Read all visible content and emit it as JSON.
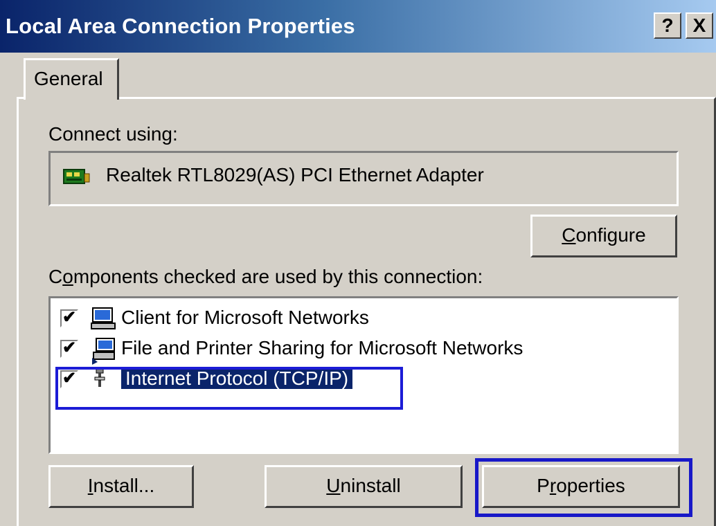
{
  "window": {
    "title": "Local Area Connection Properties",
    "help_label": "?",
    "close_label": "X"
  },
  "tabs": [
    {
      "label": "General",
      "active": true
    }
  ],
  "connect_using": {
    "label": "Connect using:",
    "adapter_name": "Realtek RTL8029(AS) PCI Ethernet Adapter",
    "icon": "network-card-icon"
  },
  "configure_button": {
    "accel": "C",
    "rest": "onfigure"
  },
  "components": {
    "label_a": "C",
    "label_accel": "o",
    "label_b": "mponents checked are used by this connection:",
    "items": [
      {
        "label": "Client for Microsoft Networks",
        "checked": true,
        "icon": "client-computer-icon",
        "selected": false
      },
      {
        "label": "File and Printer Sharing for Microsoft Networks",
        "checked": true,
        "icon": "printer-sharing-icon",
        "selected": false
      },
      {
        "label": "Internet Protocol (TCP/IP)",
        "checked": true,
        "icon": "protocol-icon",
        "selected": true
      }
    ]
  },
  "buttons": {
    "install": {
      "accel": "I",
      "rest": "nstall..."
    },
    "uninstall": {
      "accel": "U",
      "rest": "ninstall"
    },
    "properties": {
      "pre": "P",
      "accel": "r",
      "rest": "operties"
    }
  },
  "colors": {
    "titlebar_start": "#0a246a",
    "titlebar_end": "#a6caf0",
    "face": "#d4d0c8",
    "selection": "#0a246a",
    "highlight_box": "#1c1cd6"
  }
}
